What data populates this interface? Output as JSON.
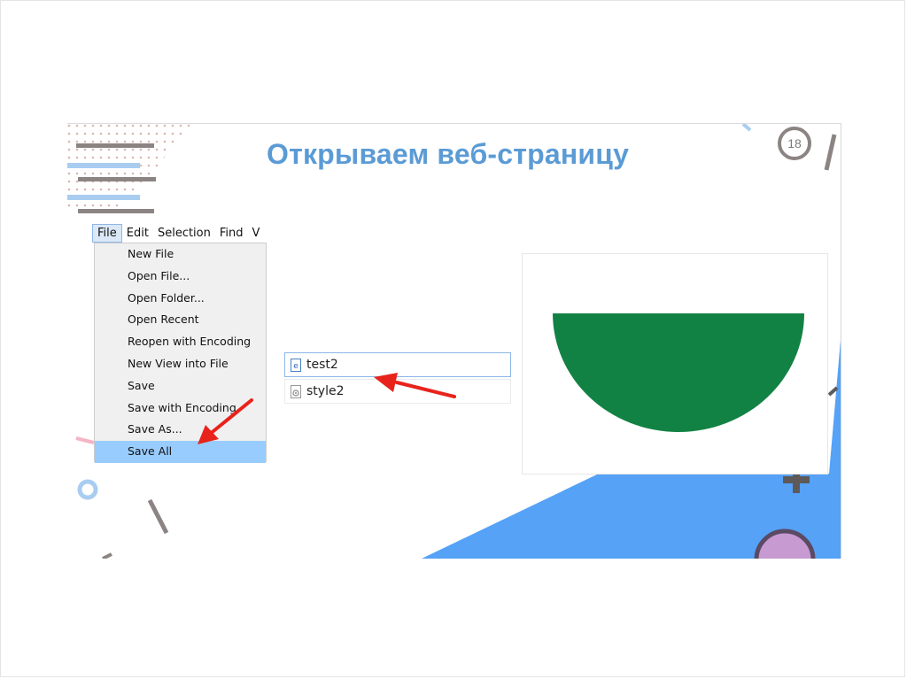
{
  "slide": {
    "title": "Открываем веб-страницу",
    "page_number": "18"
  },
  "editor": {
    "menubar": [
      {
        "label": "File",
        "active": true
      },
      {
        "label": "Edit"
      },
      {
        "label": "Selection"
      },
      {
        "label": "Find"
      },
      {
        "label": "V"
      }
    ],
    "file_menu": [
      {
        "label": "New File"
      },
      {
        "label": "Open File..."
      },
      {
        "label": "Open Folder..."
      },
      {
        "label": "Open Recent"
      },
      {
        "label": "Reopen with Encoding"
      },
      {
        "label": "New View into File"
      },
      {
        "label": "Save"
      },
      {
        "label": "Save with Encoding"
      },
      {
        "label": "Save As..."
      },
      {
        "label": "Save All",
        "highlighted": true
      }
    ]
  },
  "files": [
    {
      "name": "test2",
      "icon": "html-file-icon",
      "selected": true
    },
    {
      "name": "style2",
      "icon": "css-file-icon"
    }
  ],
  "preview": {
    "shape": "half-circle",
    "color": "#128244"
  },
  "colors": {
    "accent_blue": "#5b9bd5",
    "shape_blue": "#55a2f7",
    "annotation_red": "#e8231b",
    "menu_highlight": "#99ccfe"
  }
}
